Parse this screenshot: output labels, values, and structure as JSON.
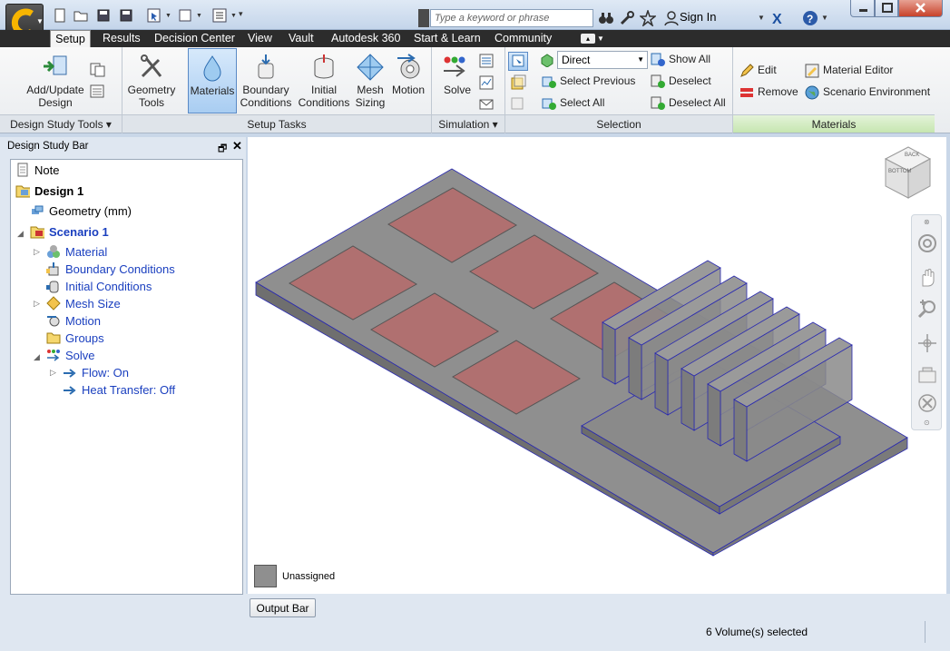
{
  "titlebar": {
    "search_placeholder": "Type a keyword or phrase",
    "sign_in": "Sign In"
  },
  "tabs": [
    "Setup",
    "Results",
    "Decision Center",
    "View",
    "Vault",
    "Autodesk 360",
    "Start & Learn",
    "Community"
  ],
  "ribbon": {
    "design_study_tools": {
      "add_update": "Add/Update\nDesign",
      "panel_label": "Design Study Tools ▾"
    },
    "setup_tasks": {
      "geometry_tools": "Geometry\nTools",
      "materials": "Materials",
      "boundary_conditions": "Boundary\nConditions",
      "initial_conditions": "Initial\nConditions",
      "mesh_sizing": "Mesh\nSizing",
      "motion": "Motion",
      "panel_label": "Setup Tasks"
    },
    "simulation": {
      "solve": "Solve",
      "panel_label": "Simulation ▾"
    },
    "selection": {
      "mode": "Direct",
      "select_previous": "Select Previous",
      "select_all": "Select All",
      "show_all": "Show All",
      "deselect": "Deselect",
      "deselect_all": "Deselect All",
      "panel_label": "Selection"
    },
    "materials": {
      "edit": "Edit",
      "remove": "Remove",
      "material_editor": "Material Editor",
      "scenario_environment": "Scenario Environment",
      "panel_label": "Materials"
    }
  },
  "design_study_bar": {
    "title": "Design Study Bar",
    "tree": {
      "note": "Note",
      "design": "Design 1",
      "geometry": "Geometry (mm)",
      "scenario": "Scenario 1",
      "material": "Material",
      "boundary_conditions": "Boundary Conditions",
      "initial_conditions": "Initial Conditions",
      "mesh_size": "Mesh Size",
      "motion": "Motion",
      "groups": "Groups",
      "solve": "Solve",
      "flow": "Flow: On",
      "heat_transfer": "Heat Transfer: Off"
    }
  },
  "viewport": {
    "legend_label": "Unassigned",
    "viewcube_labels": [
      "BACK",
      "BOTTOM"
    ]
  },
  "output_bar": "Output Bar",
  "status": "6 Volume(s) selected",
  "colors": {
    "chip": "#b07070",
    "board": "#8f8f8f",
    "selection": "#2a2ab0",
    "accent": "#f7b500"
  }
}
